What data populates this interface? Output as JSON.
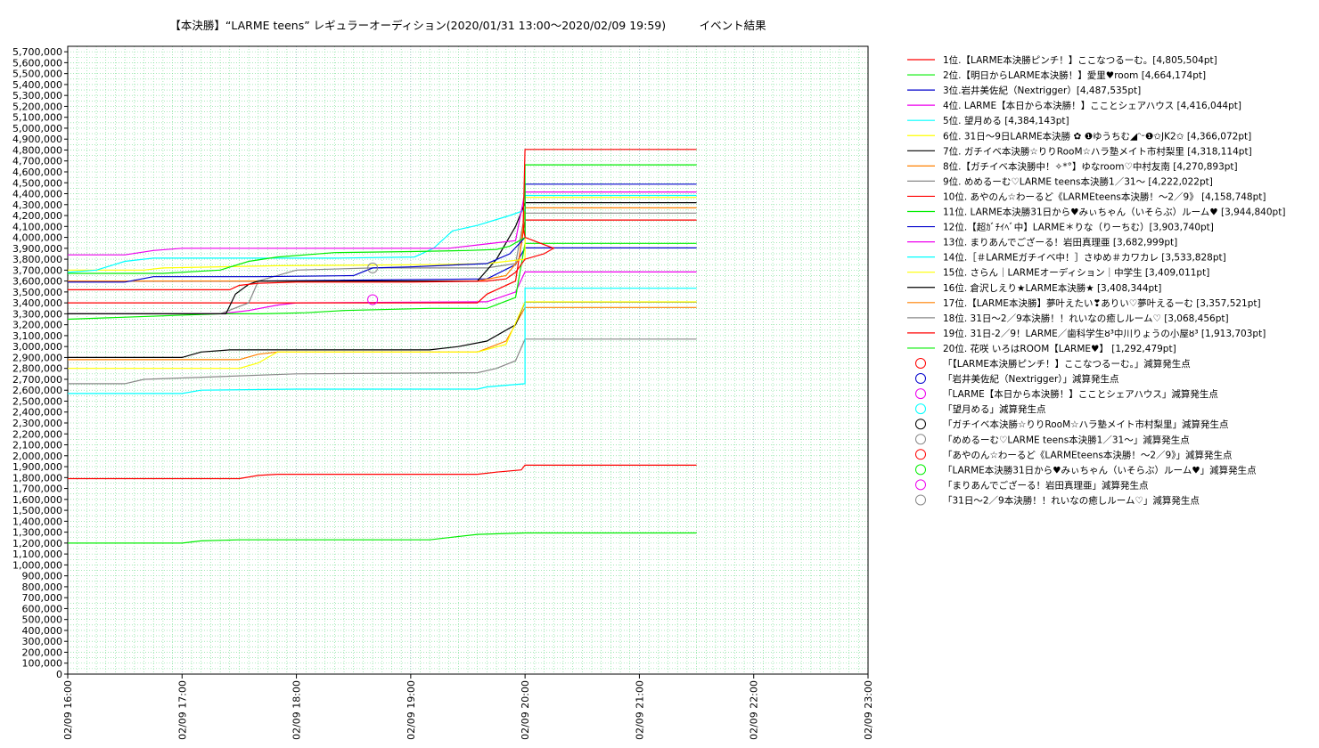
{
  "chart_data": {
    "type": "line",
    "title": "【本決勝】“LARME teens” レギュラーオーディション(2020/01/31 13:00〜2020/02/09 19:59)　　　イベント結果",
    "xlabel": "",
    "ylabel": "",
    "x_ticks": [
      "02/09 16:00",
      "02/09 17:00",
      "02/09 18:00",
      "02/09 19:00",
      "02/09 20:00",
      "02/09 21:00",
      "02/09 22:00",
      "02/09 23:00"
    ],
    "x_range_minutes": [
      960,
      1380
    ],
    "ylim": [
      0,
      5750000
    ],
    "y_tick_step": 100000,
    "grid": true,
    "legend_position": "right",
    "series": [
      {
        "name": "1位.【LARME本決勝ピンチ！】ここなつるーむ。[4,805,504pt]",
        "color": "#ff0000",
        "points": [
          [
            960,
            3520000
          ],
          [
            1045,
            3520000
          ],
          [
            1050,
            3560000
          ],
          [
            1060,
            3580000
          ],
          [
            1080,
            3590000
          ],
          [
            1140,
            3590000
          ],
          [
            1180,
            3600000
          ],
          [
            1190,
            3620000
          ],
          [
            1195,
            3680000
          ],
          [
            1200,
            3800000
          ],
          [
            1210,
            3850000
          ],
          [
            1215,
            3900000
          ],
          [
            1200,
            4000000
          ],
          [
            1199,
            4100000
          ],
          [
            1200,
            4805504
          ],
          [
            1290,
            4805504
          ]
        ]
      },
      {
        "name": "2位.【明日からLARME本決勝！】愛里♥room [4,664,174pt]",
        "color": "#00ee00",
        "points": [
          [
            960,
            3670000
          ],
          [
            1010,
            3670000
          ],
          [
            1040,
            3700000
          ],
          [
            1055,
            3780000
          ],
          [
            1070,
            3820000
          ],
          [
            1100,
            3860000
          ],
          [
            1140,
            3870000
          ],
          [
            1170,
            3880000
          ],
          [
            1185,
            3890000
          ],
          [
            1192,
            3920000
          ],
          [
            1200,
            4000000
          ],
          [
            1200,
            4664174
          ],
          [
            1290,
            4664174
          ]
        ]
      },
      {
        "name": "3位.岩井美佐紀（Nextrigger）[4,487,535pt]",
        "color": "#0000cc",
        "points": [
          [
            960,
            3590000
          ],
          [
            990,
            3590000
          ],
          [
            1005,
            3640000
          ],
          [
            1060,
            3640000
          ],
          [
            1110,
            3650000
          ],
          [
            1120,
            3720000
          ],
          [
            1140,
            3730000
          ],
          [
            1180,
            3760000
          ],
          [
            1192,
            3850000
          ],
          [
            1200,
            4000000
          ],
          [
            1200,
            4487535
          ],
          [
            1290,
            4487535
          ]
        ]
      },
      {
        "name": "4位. LARME【本日から本決勝！】こことシェアハウス [4,416,044pt]",
        "color": "#ee00ee",
        "points": [
          [
            960,
            3840000
          ],
          [
            990,
            3840000
          ],
          [
            1005,
            3880000
          ],
          [
            1020,
            3900000
          ],
          [
            1100,
            3900000
          ],
          [
            1160,
            3900000
          ],
          [
            1180,
            3940000
          ],
          [
            1195,
            3970000
          ],
          [
            1200,
            4416044
          ],
          [
            1290,
            4416044
          ]
        ]
      },
      {
        "name": "5位. 望月める [4,384,143pt]",
        "color": "#00ffff",
        "points": [
          [
            960,
            3680000
          ],
          [
            975,
            3700000
          ],
          [
            990,
            3780000
          ],
          [
            1005,
            3810000
          ],
          [
            1100,
            3810000
          ],
          [
            1142,
            3820000
          ],
          [
            1152,
            3900000
          ],
          [
            1162,
            4060000
          ],
          [
            1175,
            4110000
          ],
          [
            1192,
            4200000
          ],
          [
            1200,
            4250000
          ],
          [
            1200,
            4384143
          ],
          [
            1290,
            4384143
          ]
        ]
      },
      {
        "name": "6位. 31日〜9日LARME本決勝 ✿ ❶ゆうちむ◢ᵔᵕ❶✩JK2✩ [4,366,072pt]",
        "color": "#ffff00",
        "points": [
          [
            960,
            3700000
          ],
          [
            1000,
            3700000
          ],
          [
            1010,
            3720000
          ],
          [
            1070,
            3740000
          ],
          [
            1150,
            3750000
          ],
          [
            1180,
            3760000
          ],
          [
            1200,
            3800000
          ],
          [
            1200,
            4366072
          ],
          [
            1290,
            4366072
          ]
        ]
      },
      {
        "name": "7位. ガチイベ本決勝☆りりRooM☆ハラ塾メイト市村梨里 [4,318,114pt]",
        "color": "#000000",
        "points": [
          [
            960,
            3300000
          ],
          [
            1043,
            3300000
          ],
          [
            1048,
            3480000
          ],
          [
            1055,
            3570000
          ],
          [
            1060,
            3600000
          ],
          [
            1175,
            3600000
          ],
          [
            1185,
            3800000
          ],
          [
            1195,
            4100000
          ],
          [
            1200,
            4318114
          ],
          [
            1290,
            4318114
          ]
        ]
      },
      {
        "name": "8位.【ガチイベ本決勝中！✧*°】ゆなroom♡中村友南 [4,270,893pt]",
        "color": "#ff8000",
        "points": [
          [
            960,
            3600000
          ],
          [
            1070,
            3600000
          ],
          [
            1175,
            3600000
          ],
          [
            1190,
            3650000
          ],
          [
            1197,
            3800000
          ],
          [
            1200,
            4270893
          ],
          [
            1290,
            4270893
          ]
        ]
      },
      {
        "name": "9位. めめるーむ♡LARME teens本決勝1／31〜 [4,222,022pt]",
        "color": "#888888",
        "points": [
          [
            960,
            3300000
          ],
          [
            1040,
            3300000
          ],
          [
            1055,
            3400000
          ],
          [
            1060,
            3600000
          ],
          [
            1080,
            3700000
          ],
          [
            1120,
            3720000
          ],
          [
            1180,
            3720000
          ],
          [
            1195,
            3760000
          ],
          [
            1200,
            4222022
          ],
          [
            1290,
            4222022
          ]
        ]
      },
      {
        "name": "10位. あやのん☆わーるど《LARMEteens本決勝！〜2／9》 [4,158,748pt]",
        "color": "#ff0000",
        "points": [
          [
            960,
            3400000
          ],
          [
            1080,
            3400000
          ],
          [
            1175,
            3400000
          ],
          [
            1180,
            3480000
          ],
          [
            1195,
            3600000
          ],
          [
            1200,
            4158748
          ],
          [
            1290,
            4158748
          ]
        ]
      },
      {
        "name": "11位. LARME本決勝31日から♥みぃちゃん（いそらぶ）ルーム♥ [3,944,840pt]",
        "color": "#00ee00",
        "points": [
          [
            960,
            3250000
          ],
          [
            1040,
            3300000
          ],
          [
            1062,
            3300000
          ],
          [
            1085,
            3310000
          ],
          [
            1105,
            3330000
          ],
          [
            1150,
            3350000
          ],
          [
            1180,
            3350000
          ],
          [
            1195,
            3450000
          ],
          [
            1200,
            3944840
          ],
          [
            1290,
            3944840
          ]
        ]
      },
      {
        "name": "12位.【超ｶﾞﾁｲﾍﾞ中】LARME＊りな（りーちむ）[3,903,740pt]",
        "color": "#0000cc",
        "points": [
          [
            960,
            3600000
          ],
          [
            1060,
            3600000
          ],
          [
            1180,
            3620000
          ],
          [
            1195,
            3750000
          ],
          [
            1200,
            3903740
          ],
          [
            1290,
            3903740
          ]
        ]
      },
      {
        "name": "13位. まりあんでござーる！岩田真理亜 [3,682,999pt]",
        "color": "#ee00ee",
        "points": [
          [
            960,
            3300000
          ],
          [
            1040,
            3300000
          ],
          [
            1055,
            3330000
          ],
          [
            1070,
            3380000
          ],
          [
            1080,
            3400000
          ],
          [
            1180,
            3410000
          ],
          [
            1195,
            3500000
          ],
          [
            1200,
            3682999
          ],
          [
            1290,
            3682999
          ]
        ]
      },
      {
        "name": "14位.［＃LARMEガチイベ中！］さゆめ＃カワカレ [3,533,828pt]",
        "color": "#00ffff",
        "points": [
          [
            960,
            2570000
          ],
          [
            1020,
            2570000
          ],
          [
            1030,
            2600000
          ],
          [
            1080,
            2610000
          ],
          [
            1175,
            2610000
          ],
          [
            1180,
            2630000
          ],
          [
            1200,
            2660000
          ],
          [
            1200,
            3533828
          ],
          [
            1290,
            3533828
          ]
        ]
      },
      {
        "name": "15位. さらん｜LARMEオーディション｜中学生 [3,409,011pt]",
        "color": "#ffff00",
        "points": [
          [
            960,
            2800000
          ],
          [
            1050,
            2800000
          ],
          [
            1060,
            2850000
          ],
          [
            1070,
            2950000
          ],
          [
            1175,
            2950000
          ],
          [
            1190,
            3020000
          ],
          [
            1200,
            3409011
          ],
          [
            1290,
            3409011
          ]
        ]
      },
      {
        "name": "16位. 倉沢しえり★LARME本決勝★ [3,408,344pt]",
        "color": "#000000",
        "points": [
          [
            960,
            2900000
          ],
          [
            1020,
            2900000
          ],
          [
            1030,
            2950000
          ],
          [
            1045,
            2970000
          ],
          [
            1150,
            2970000
          ],
          [
            1165,
            3000000
          ],
          [
            1180,
            3050000
          ],
          [
            1195,
            3200000
          ],
          [
            1200,
            3408344
          ],
          [
            1290,
            3408344
          ]
        ]
      },
      {
        "name": "17位.【LARME本決勝】夢叶えたい❣ありい♡夢叶えるーむ [3,357,521pt]",
        "color": "#ff8000",
        "points": [
          [
            960,
            2880000
          ],
          [
            1050,
            2880000
          ],
          [
            1060,
            2930000
          ],
          [
            1070,
            2950000
          ],
          [
            1175,
            2950000
          ],
          [
            1190,
            3050000
          ],
          [
            1200,
            3357521
          ],
          [
            1290,
            3357521
          ]
        ]
      },
      {
        "name": "18位. 31日〜2／9本決勝！！れいなの癒しルーム♡ [3,068,456pt]",
        "color": "#888888",
        "points": [
          [
            960,
            2660000
          ],
          [
            990,
            2660000
          ],
          [
            1000,
            2700000
          ],
          [
            1080,
            2750000
          ],
          [
            1175,
            2760000
          ],
          [
            1185,
            2800000
          ],
          [
            1195,
            2870000
          ],
          [
            1200,
            3068456
          ],
          [
            1290,
            3068456
          ]
        ]
      },
      {
        "name": "19位. 31日-2／9！LARME／歯科学生ȣ³中川りょうの小屋ȣ³ [1,913,703pt]",
        "color": "#ff0000",
        "points": [
          [
            960,
            1790000
          ],
          [
            1050,
            1790000
          ],
          [
            1060,
            1820000
          ],
          [
            1070,
            1830000
          ],
          [
            1175,
            1830000
          ],
          [
            1185,
            1850000
          ],
          [
            1198,
            1870000
          ],
          [
            1200,
            1913703
          ],
          [
            1290,
            1913703
          ]
        ]
      },
      {
        "name": "20位. 花咲 いろはROOM【LARME♥】 [1,292,479pt]",
        "color": "#00ee00",
        "points": [
          [
            960,
            1200000
          ],
          [
            1020,
            1200000
          ],
          [
            1030,
            1220000
          ],
          [
            1050,
            1230000
          ],
          [
            1150,
            1230000
          ],
          [
            1160,
            1250000
          ],
          [
            1175,
            1280000
          ],
          [
            1200,
            1292479
          ],
          [
            1290,
            1292479
          ]
        ]
      }
    ],
    "markers": [
      {
        "name": "「【LARME本決勝ピンチ！】ここなつるーむ。」減算発生点",
        "color": "#ff0000",
        "points": []
      },
      {
        "name": "「岩井美佐紀（Nextrigger）」減算発生点",
        "color": "#0000cc",
        "points": []
      },
      {
        "name": "「LARME【本日から本決勝！】こことシェアハウス」減算発生点",
        "color": "#ee00ee",
        "points": [
          [
            1120,
            3430000
          ]
        ]
      },
      {
        "name": "「望月める」減算発生点",
        "color": "#00ffff",
        "points": []
      },
      {
        "name": "「ガチイベ本決勝☆りりRooM☆ハラ塾メイト市村梨里」減算発生点",
        "color": "#000000",
        "points": []
      },
      {
        "name": "「めめるーむ♡LARME teens本決勝1／31〜」減算発生点",
        "color": "#888888",
        "points": [
          [
            1120,
            3720000
          ]
        ]
      },
      {
        "name": "「あやのん☆わーるど《LARMEteens本決勝！〜2／9》」減算発生点",
        "color": "#ff0000",
        "points": []
      },
      {
        "name": "「LARME本決勝31日から♥みぃちゃん（いそらぶ）ルーム♥」減算発生点",
        "color": "#00ee00",
        "points": []
      },
      {
        "name": "「まりあんでござーる！岩田真理亜」減算発生点",
        "color": "#ee00ee",
        "points": []
      },
      {
        "name": "「31日〜2／9本決勝！！れいなの癒しルーム♡」減算発生点",
        "color": "#888888",
        "points": []
      }
    ]
  }
}
